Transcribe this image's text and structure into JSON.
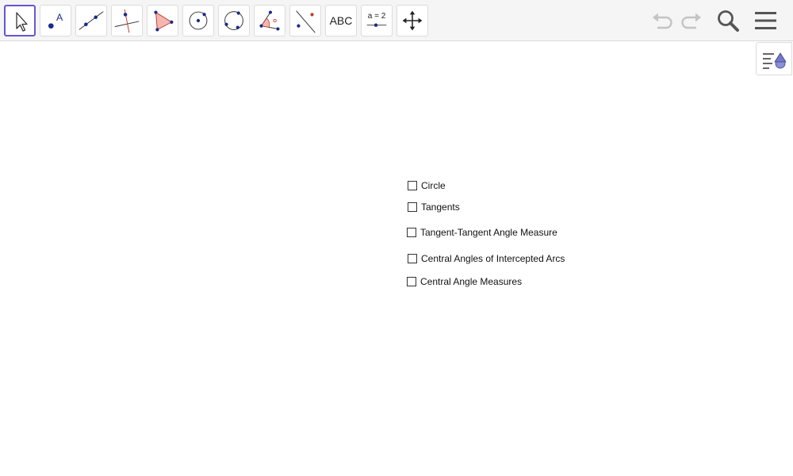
{
  "toolbar": {
    "tools": [
      {
        "name": "move-tool",
        "text": ""
      },
      {
        "name": "point-tool",
        "text": ""
      },
      {
        "name": "line-tool",
        "text": ""
      },
      {
        "name": "perpendicular-line-tool",
        "text": ""
      },
      {
        "name": "polygon-tool",
        "text": ""
      },
      {
        "name": "circle-center-point-tool",
        "text": ""
      },
      {
        "name": "circle-through-points-tool",
        "text": ""
      },
      {
        "name": "angle-tool",
        "text": ""
      },
      {
        "name": "reflect-tool",
        "text": ""
      },
      {
        "name": "text-tool",
        "text": "ABC"
      },
      {
        "name": "slider-tool",
        "text": "a = 2"
      },
      {
        "name": "move-view-tool",
        "text": ""
      }
    ],
    "header_icons": [
      "undo-icon",
      "redo-icon",
      "search-icon",
      "menu-icon"
    ],
    "accent_color": "#6557d2"
  },
  "checkboxes": [
    {
      "label": "Circle",
      "checked": false
    },
    {
      "label": "Tangents",
      "checked": false
    },
    {
      "label": "Tangent-Tangent Angle Measure",
      "checked": false
    },
    {
      "label": "Central Angles of Intercepted Arcs",
      "checked": false
    },
    {
      "label": "Central Angle Measures",
      "checked": false
    }
  ]
}
